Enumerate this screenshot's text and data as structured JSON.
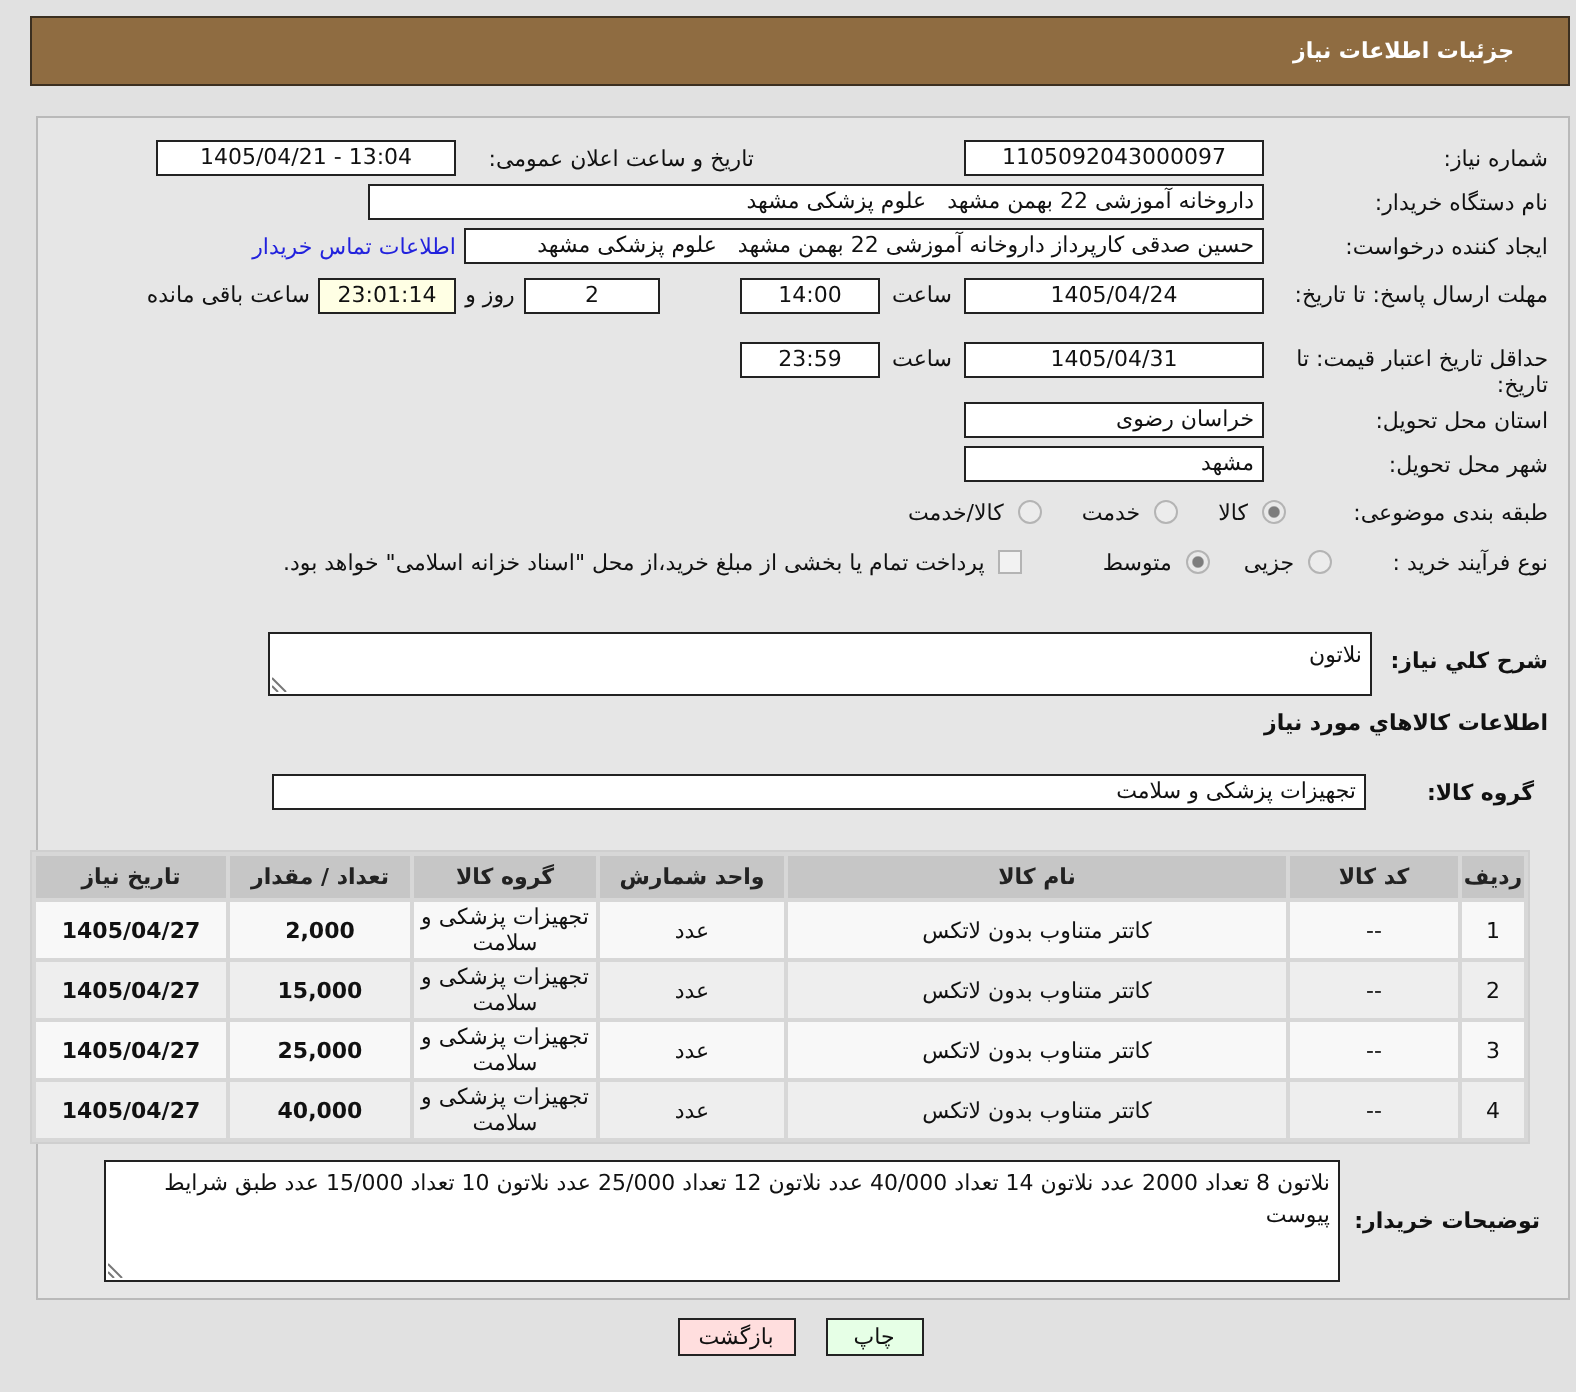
{
  "header": {
    "title": "جزئیات اطلاعات نیاز"
  },
  "need_number": {
    "label": "شماره نیاز:",
    "value": "1105092043000097"
  },
  "announcement": {
    "label": "تاریخ و ساعت اعلان عمومی:",
    "value": "1405/04/21 - 13:04"
  },
  "buyer_org": {
    "label": "نام دستگاه خریدار:",
    "value": "داروخانه آموزشی 22 بهمن مشهد   علوم پزشکی مشهد"
  },
  "requester": {
    "label": "ایجاد کننده درخواست:",
    "value": "حسین صدقی کارپرداز داروخانه آموزشی 22 بهمن مشهد   علوم پزشکی مشهد",
    "contact_link": "اطلاعات تماس خریدار"
  },
  "reply_deadline": {
    "label": "مهلت ارسال پاسخ: تا تاریخ:",
    "date": "1405/04/24",
    "time_label": "ساعت",
    "time": "14:00",
    "days": "2",
    "days_label": "روز و",
    "remaining": "23:01:14",
    "remaining_label": "ساعت باقی مانده"
  },
  "price_validity": {
    "label": "حداقل تاریخ اعتبار قیمت: تا تاریخ:",
    "date": "1405/04/31",
    "time_label": "ساعت",
    "time": "23:59"
  },
  "delivery_province": {
    "label": "استان محل تحویل:",
    "value": "خراسان رضوی"
  },
  "delivery_city": {
    "label": "شهر محل تحویل:",
    "value": "مشهد"
  },
  "subject_category": {
    "label": "طبقه بندی موضوعی:",
    "options": [
      {
        "label": "کالا",
        "selected": true
      },
      {
        "label": "خدمت",
        "selected": false
      },
      {
        "label": "کالا/خدمت",
        "selected": false
      }
    ]
  },
  "purchase_process": {
    "label": "نوع فرآیند خرید :",
    "options": [
      {
        "label": "جزیی",
        "selected": false
      },
      {
        "label": "متوسط",
        "selected": true
      }
    ],
    "treasury_payment": {
      "label": "پرداخت تمام یا بخشی از مبلغ خرید،از محل \"اسناد خزانه اسلامی\" خواهد بود.",
      "checked": false
    }
  },
  "general_description": {
    "label": "شرح کلي نیاز:",
    "value": "نلاتون"
  },
  "items_heading": "اطلاعات کالاهاي مورد نیاز",
  "goods_group": {
    "label": "گروه کالا:",
    "value": "تجهیزات پزشکی و سلامت"
  },
  "table": {
    "columns": [
      "ردیف",
      "کد کالا",
      "نام کالا",
      "واحد شمارش",
      "گروه کالا",
      "تعداد / مقدار",
      "تاریخ نیاز"
    ],
    "rows": [
      [
        "1",
        "--",
        "کاتتر متناوب بدون لاتکس",
        "عدد",
        "تجهیزات پزشکی و سلامت",
        "2,000",
        "1405/04/27"
      ],
      [
        "2",
        "--",
        "کاتتر متناوب بدون لاتکس",
        "عدد",
        "تجهیزات پزشکی و سلامت",
        "15,000",
        "1405/04/27"
      ],
      [
        "3",
        "--",
        "کاتتر متناوب بدون لاتکس",
        "عدد",
        "تجهیزات پزشکی و سلامت",
        "25,000",
        "1405/04/27"
      ],
      [
        "4",
        "--",
        "کاتتر متناوب بدون لاتکس",
        "عدد",
        "تجهیزات پزشکی و سلامت",
        "40,000",
        "1405/04/27"
      ]
    ]
  },
  "buyer_notes": {
    "label": "توضیحات خریدار:",
    "value": "نلاتون 8 تعداد 2000 عدد نلاتون 14 تعداد 40/000 عدد نلاتون 12 تعداد 25/000 عدد نلاتون 10 تعداد 15/000 عدد طبق شرایط پیوست"
  },
  "buttons": [
    {
      "label": "چاپ",
      "kind": "print"
    },
    {
      "label": "بازگشت",
      "kind": "back"
    }
  ]
}
